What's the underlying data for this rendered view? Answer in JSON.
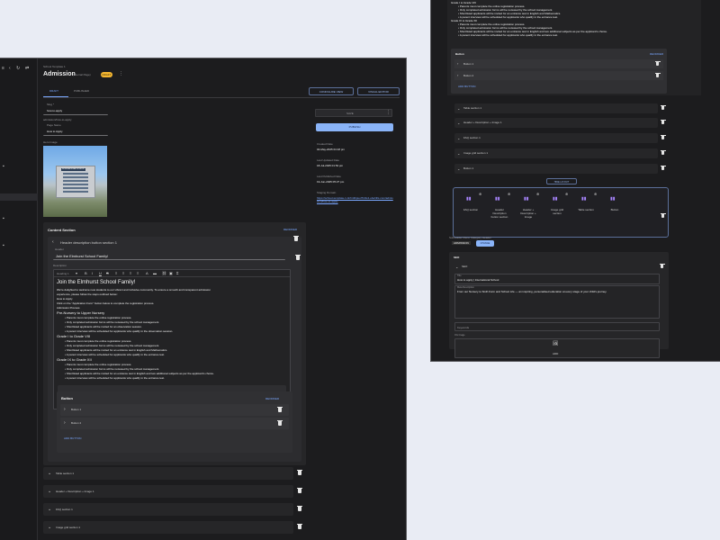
{
  "left": {
    "breadcrumb": "School Template 1",
    "title": "Admission",
    "title_sub": "(internal Page)",
    "badge": "DRAFT",
    "tabs": [
      "DRAFT",
      "PUBLISHED"
    ],
    "configure_view": "CONFIGURE VIEW",
    "visual_editor": "VISUAL EDITOR",
    "slug_label": "Slug *",
    "slug_value": "how-to-apply",
    "slug_path": "admission/how-to-apply",
    "page_name_label": "Page Name",
    "page_name_value": "How to Apply",
    "hero_label": "Hero Image",
    "hero_sign": "INTERNATIONAL SCHOOL",
    "save": "SAVE",
    "publish": "PUBLISH",
    "created_label": "Created Date",
    "created_value": "04-May-2025 04:18 pm",
    "updated_label": "Last Updated Date",
    "updated_value": "18-Jul-2025 01:52 pm",
    "published_label": "Last Published Date",
    "published_value": "19-Jun-2025 05:27 pm",
    "staging_label": "Staging Domain",
    "staging_value": "https://school-template-1-4nfm3bpuo7bi3w1.ebehills.com/admission/how-to-apply",
    "content_section": "Content Section",
    "reorder": "REORDER",
    "section_title": "Header description button section 1",
    "header_label": "Header",
    "header_value": "Join the  Elmhurst School Family!",
    "description_label": "Description",
    "heading_select": "Heading 1",
    "rich": {
      "h": "Join the Elmhurst School Family!",
      "p1": "We're delighted to welcome new students to our vibrant and inclusive community. To ensure a smooth and transparent admission",
      "p2": "experience, please follow the steps outlined below:",
      "l1": "How to Apply",
      "l2": "Click on the \"Application Form\" button below to complete the registration process.",
      "l3": "Admission Process",
      "g1": "Pre-Nursery to Upper Nursery",
      "g1b1": "• Parents must complete the online registration process.",
      "g1b2": "• Only completed admission forms will be reviewed by the school management.",
      "g1b3": "• Shortlisted applicants will be invited for an observation session.",
      "g1b4": "• A parent interview will be scheduled for applicants who qualify in the observation session.",
      "g2": "Grade I to Grade VIII",
      "g2b1": "• Parents must complete the online registration process.",
      "g2b2": "• Only completed admission forms will be reviewed by the school management.",
      "g2b3": "• Shortlisted applicants will be invited for an entrance test in English and Mathematics.",
      "g2b4": "• A parent interview will be scheduled for applicants who qualify in the entrance test.",
      "g3": "Grade IX to Grade XII",
      "g3b1": "• Parents must complete the online registration process.",
      "g3b2": "• Only completed admission forms will be reviewed by the school management.",
      "g3b3": "• Shortlisted applicants will be invited for an entrance test in English and two additional subjects as per the applicant's choice.",
      "g3b4": "• A parent interview will be scheduled for applicants who qualify in the entrance test."
    },
    "button_block": "Button",
    "button_items": [
      "Button 1",
      "Button 2"
    ],
    "add_button": "ADD BUTTON",
    "sections": [
      "Table section 1",
      "Header + Description + Image 1",
      "FAQ section 1",
      "Image grid section 1"
    ]
  },
  "right": {
    "top_text": [
      "Grade I to Grade VIII",
      "• Parents must complete the online registration process.",
      "• Only completed admission forms will be reviewed by the school management.",
      "• Shortlisted applicants will be invited for an entrance test in English and Mathematics.",
      "• A parent interview will be scheduled for applicants who qualify in the entrance test.",
      "Grade IX to Grade XII",
      "• Parents must complete the online registration process.",
      "• Only completed admission forms will be reviewed by the school management.",
      "• Shortlisted applicants will be invited for an entrance test in English and two additional subjects as per the applicant's choice.",
      "• A parent interview will be scheduled for applicants who qualify in the entrance test."
    ],
    "button_block": "Button",
    "reorder": "REORDER",
    "button_items": [
      "Button 1",
      "Button 2"
    ],
    "add_button": "ADD BUTTON",
    "sections": [
      "Table section 1",
      "Header + Description + Image 1",
      "FAQ section 1",
      "Image grid section 1",
      "Button 1"
    ],
    "hide_layout": "HIDE LAYOUT",
    "layouts": [
      "FAQ section",
      "Header Description button section",
      "Header + Description + Image",
      "Image grid section",
      "Table section",
      "Button"
    ],
    "submenu_label": "Subheader Menu Category Header",
    "submenu_chip": "ADMISSION",
    "change": "CHANGE",
    "seo": "SEO",
    "seo_sub": "SEO",
    "title_label": "Title",
    "title_value": "How to apply | International School",
    "meta_label": "Meta Description",
    "meta_value": "From our Nursery to Sixth Form and School Life — an inspiring, personalised education at every stage of your child's journey.",
    "keywords": "Keywords",
    "og_label": "OG Image",
    "add": "ADD"
  },
  "colors": {
    "accent": "#7aa7ff",
    "badge": "#f5b731",
    "publish": "#8ab4f8",
    "bg": "#1c1c1e"
  }
}
